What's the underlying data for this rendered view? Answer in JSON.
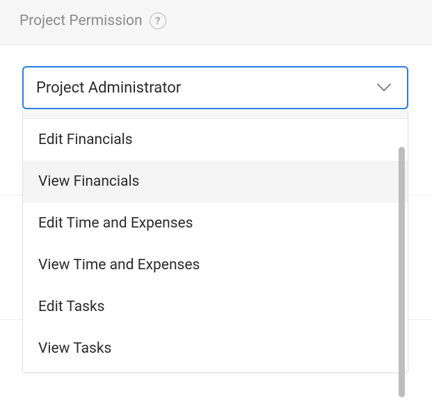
{
  "field": {
    "label": "Project Permission"
  },
  "select": {
    "value": "Project Administrator"
  },
  "options": [
    {
      "label": "Edit Financials",
      "hovered": false
    },
    {
      "label": "View Financials",
      "hovered": true
    },
    {
      "label": "Edit Time and Expenses",
      "hovered": false
    },
    {
      "label": "View Time and Expenses",
      "hovered": false
    },
    {
      "label": "Edit Tasks",
      "hovered": false
    },
    {
      "label": "View Tasks",
      "hovered": false
    }
  ]
}
